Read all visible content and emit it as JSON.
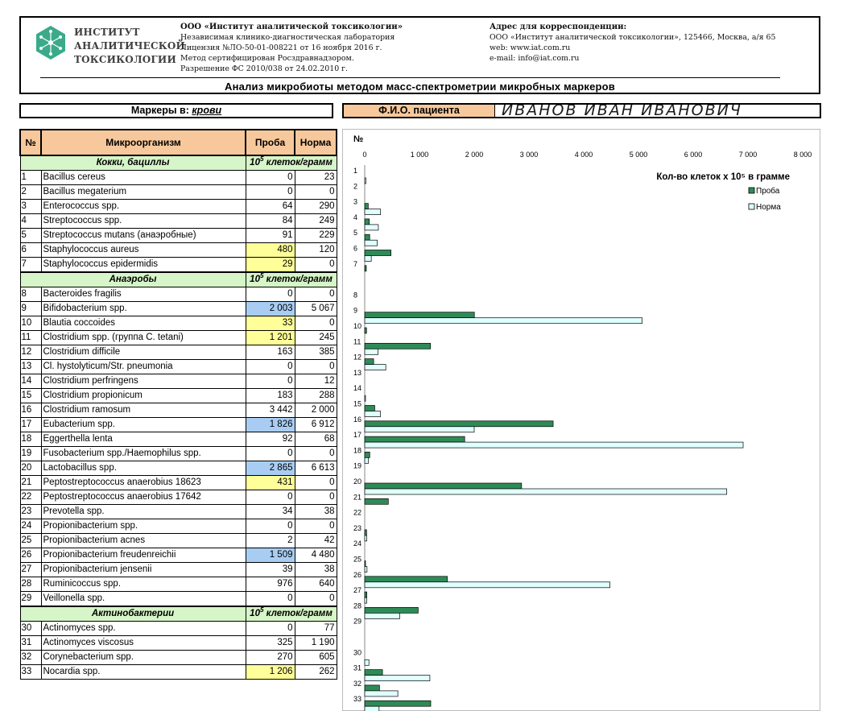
{
  "header": {
    "institute_lines": [
      "ИНСТИТУТ",
      "АНАЛИТИЧЕСКОЙ",
      "ТОКСИКОЛОГИИ"
    ],
    "org_lines": [
      "ООО «Институт аналитической токсикологии»",
      "Независимая клинико-диагностическая лаборатория",
      "Лицензия №ЛО-50-01-008221 от 16 ноября 2016 г.",
      "Метод сертифицирован Росздравнадзором.",
      "Разрешение ФС 2010/038 от 24.02.2010 г."
    ],
    "addr_lines": [
      "Адрес для корреспонденции:",
      "ООО «Институт аналитической токсикологии», 125466, Москва, а/я 65",
      "web: www.iat.com.ru",
      "e-mail: info@iat.com.ru"
    ],
    "analysis_title": "Анализ микробиоты методом масс-спектрометрии микробных маркеров"
  },
  "markers": {
    "label": "Маркеры в:",
    "value": "крови"
  },
  "patient": {
    "label": "Ф.И.О. пациента",
    "value": "ИВАНОВ ИВАН ИВАНОВИЧ"
  },
  "table": {
    "headers": [
      "№",
      "Микроорганизм",
      "Проба",
      "Норма"
    ],
    "units_prefix": "10",
    "units_sup": "5",
    "units_suffix": " клеток/грамм",
    "sections": [
      {
        "title": "Кокки, бациллы",
        "rows": [
          {
            "n": "1",
            "name": "Bacillus cereus",
            "sample": "0",
            "norm": "23",
            "hl": ""
          },
          {
            "n": "2",
            "name": "Bacillus megaterium",
            "sample": "0",
            "norm": "0",
            "hl": ""
          },
          {
            "n": "3",
            "name": "Enterococcus spp.",
            "sample": "64",
            "norm": "290",
            "hl": ""
          },
          {
            "n": "4",
            "name": "Streptococcus spp.",
            "sample": "84",
            "norm": "249",
            "hl": ""
          },
          {
            "n": "5",
            "name": "Streptococcus mutans (анаэробные)",
            "sample": "91",
            "norm": "229",
            "hl": ""
          },
          {
            "n": "6",
            "name": "Staphylococcus aureus",
            "sample": "480",
            "norm": "120",
            "hl": "y"
          },
          {
            "n": "7",
            "name": "Staphylococcus epidermidis",
            "sample": "29",
            "norm": "0",
            "hl": "y"
          }
        ]
      },
      {
        "title": "Анаэробы",
        "rows": [
          {
            "n": "8",
            "name": "Bacteroides fragilis",
            "sample": "0",
            "norm": "0",
            "hl": ""
          },
          {
            "n": "9",
            "name": "Bifidobacterium spp.",
            "sample": "2 003",
            "norm": "5 067",
            "hl": "b"
          },
          {
            "n": "10",
            "name": "Blautia coccoides",
            "sample": "33",
            "norm": "0",
            "hl": "y"
          },
          {
            "n": "11",
            "name": "Clostridium spp. (группа C. tetani)",
            "sample": "1 201",
            "norm": "245",
            "hl": "y"
          },
          {
            "n": "12",
            "name": "Clostridium difficile",
            "sample": "163",
            "norm": "385",
            "hl": ""
          },
          {
            "n": "13",
            "name": "Cl. hystolyticum/Str. pneumonia",
            "sample": "0",
            "norm": "0",
            "hl": ""
          },
          {
            "n": "14",
            "name": "Clostridium perfringens",
            "sample": "0",
            "norm": "12",
            "hl": ""
          },
          {
            "n": "15",
            "name": "Clostridium propionicum",
            "sample": "183",
            "norm": "288",
            "hl": ""
          },
          {
            "n": "16",
            "name": "Clostridium ramosum",
            "sample": "3 442",
            "norm": "2 000",
            "hl": ""
          },
          {
            "n": "17",
            "name": "Eubacterium spp.",
            "sample": "1 826",
            "norm": "6 912",
            "hl": "b"
          },
          {
            "n": "18",
            "name": "Eggerthella lenta",
            "sample": "92",
            "norm": "68",
            "hl": ""
          },
          {
            "n": "19",
            "name": "Fusobacterium spp./Haemophilus spp.",
            "sample": "0",
            "norm": "0",
            "hl": ""
          },
          {
            "n": "20",
            "name": "Lactobacillus spp.",
            "sample": "2 865",
            "norm": "6 613",
            "hl": "b"
          },
          {
            "n": "21",
            "name": "Peptostreptococcus anaerobius 18623",
            "sample": "431",
            "norm": "0",
            "hl": "y"
          },
          {
            "n": "22",
            "name": "Peptostreptococcus anaerobius 17642",
            "sample": "0",
            "norm": "0",
            "hl": ""
          },
          {
            "n": "23",
            "name": "Prevotella spp.",
            "sample": "34",
            "norm": "38",
            "hl": ""
          },
          {
            "n": "24",
            "name": "Propionibacterium  spp.",
            "sample": "0",
            "norm": "0",
            "hl": ""
          },
          {
            "n": "25",
            "name": "Propionibacterium acnes",
            "sample": "2",
            "norm": "42",
            "hl": ""
          },
          {
            "n": "26",
            "name": "Propionibacterium freudenreichii",
            "sample": "1 509",
            "norm": "4 480",
            "hl": "b"
          },
          {
            "n": "27",
            "name": "Propionibacterium jensenii",
            "sample": "39",
            "norm": "38",
            "hl": ""
          },
          {
            "n": "28",
            "name": "Ruminicoccus spp.",
            "sample": "976",
            "norm": "640",
            "hl": ""
          },
          {
            "n": "29",
            "name": "Veillonella spp.",
            "sample": "0",
            "norm": "0",
            "hl": ""
          }
        ]
      },
      {
        "title": "Актинобактерии",
        "rows": [
          {
            "n": "30",
            "name": "Actinomyces spp.",
            "sample": "0",
            "norm": "77",
            "hl": ""
          },
          {
            "n": "31",
            "name": "Actinomyces viscosus",
            "sample": "325",
            "norm": "1 190",
            "hl": ""
          },
          {
            "n": "32",
            "name": "Corynebacterium spp.",
            "sample": "270",
            "norm": "605",
            "hl": ""
          },
          {
            "n": "33",
            "name": "Nocardia  spp.",
            "sample": "1 206",
            "norm": "262",
            "hl": "y"
          }
        ]
      }
    ]
  },
  "chart_data": {
    "type": "bar",
    "orientation": "horizontal",
    "category_axis_title": "№",
    "title": "Кол-во клеток х 10⁵ в грамме",
    "xlim": [
      0,
      8000
    ],
    "xticks": [
      0,
      1000,
      2000,
      3000,
      4000,
      5000,
      6000,
      7000,
      8000
    ],
    "xtick_labels": [
      "0",
      "1 000",
      "2 000",
      "3 000",
      "4 000",
      "5 000",
      "6 000",
      "7 000",
      "8 000"
    ],
    "legend_position": "top-right",
    "categories": [
      "1",
      "2",
      "3",
      "4",
      "5",
      "6",
      "7",
      "",
      "8",
      "9",
      "10",
      "11",
      "12",
      "13",
      "14",
      "15",
      "16",
      "17",
      "18",
      "19",
      "20",
      "21",
      "22",
      "23",
      "24",
      "25",
      "26",
      "27",
      "28",
      "29",
      "",
      "30",
      "31",
      "32",
      "33"
    ],
    "series": [
      {
        "name": "Проба",
        "color": "#2e8b57",
        "values": [
          0,
          0,
          64,
          84,
          91,
          480,
          29,
          null,
          0,
          2003,
          33,
          1201,
          163,
          0,
          0,
          183,
          3442,
          1826,
          92,
          0,
          2865,
          431,
          0,
          34,
          0,
          2,
          1509,
          39,
          976,
          0,
          null,
          0,
          325,
          270,
          1206
        ]
      },
      {
        "name": "Норма",
        "color": "#e0ffff",
        "values": [
          23,
          0,
          290,
          249,
          229,
          120,
          0,
          null,
          0,
          5067,
          0,
          245,
          385,
          0,
          12,
          288,
          2000,
          6912,
          68,
          0,
          6613,
          0,
          0,
          38,
          0,
          42,
          4480,
          38,
          640,
          0,
          null,
          77,
          1190,
          605,
          262
        ]
      }
    ]
  }
}
